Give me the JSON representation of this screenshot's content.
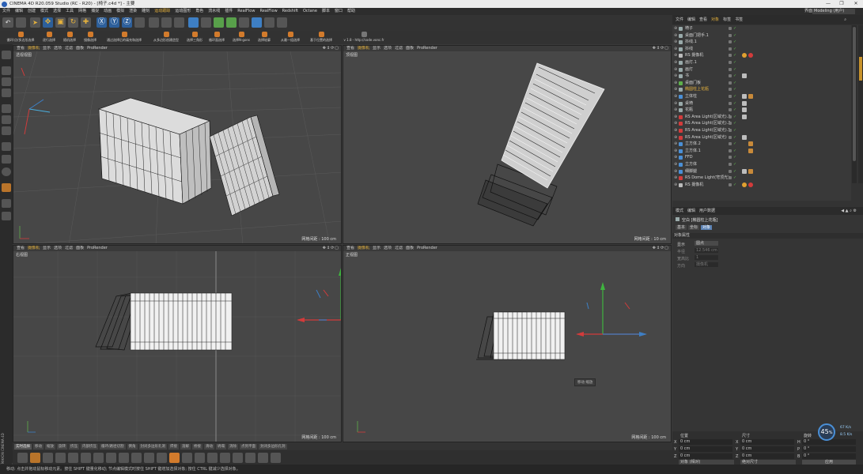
{
  "window": {
    "title": "CINEMA 4D R20.059 Studio (RC - R20) - [椅子.c4d *] - 主要",
    "controls": [
      "—",
      "❐",
      "✕"
    ]
  },
  "menubar": {
    "items": [
      "文件",
      "编辑",
      "创建",
      "模式",
      "选择",
      "工具",
      "网格",
      "捕捉",
      "动画",
      "模拟",
      "渲染",
      "雕刻",
      "运动跟踪",
      "运动图形",
      "角色",
      "流水线",
      "插件",
      "RealFlow",
      "RealFlow",
      "Redshift",
      "Octane",
      "脚本",
      "窗口",
      "帮助"
    ],
    "highlighted": "运动跟踪",
    "right_label": "界面",
    "layout_value": "Modeling (用户)"
  },
  "plugin_bar": {
    "items": [
      "循环/点/多边形选择",
      "逐行选择",
      "随机选择",
      "镜像选择",
      "通过选择后的填充和选择",
      "从多边形创建造型",
      "选择三角形",
      "循环面选择",
      "选择N-gons",
      "选择轮廓",
      "从最一组选择",
      "基于位置的选择"
    ],
    "version_label": "v 1.8 - http://code.vonc.fr"
  },
  "viewports": [
    {
      "id": "persp",
      "menu": [
        "查看",
        "摄像机",
        "显示",
        "选项",
        "过滤",
        "面板",
        "ProRender"
      ],
      "name": "透视视图",
      "grid": "网格间距 : 100 cm"
    },
    {
      "id": "top",
      "menu": [
        "查看",
        "摄像机",
        "显示",
        "选项",
        "过滤",
        "面板",
        "ProRender"
      ],
      "name": "顶视图",
      "grid": "网格间距 : 10 cm"
    },
    {
      "id": "right",
      "menu": [
        "查看",
        "摄像机",
        "显示",
        "选项",
        "过滤",
        "面板",
        "ProRender"
      ],
      "name": "右视图",
      "grid": "网格间距 : 100 cm"
    },
    {
      "id": "front",
      "menu": [
        "查看",
        "摄像机",
        "显示",
        "选项",
        "过滤",
        "面板",
        "ProRender"
      ],
      "name": "正视图",
      "grid": "网格间距 : 100 cm"
    }
  ],
  "objects_panel": {
    "tabs": [
      "文件",
      "编辑",
      "查看",
      "对象",
      "标签",
      "书签"
    ],
    "highlighted_tab": "对象",
    "items": [
      {
        "name": "椅子",
        "icon": "null-object-icon",
        "color": "#9aa"
      },
      {
        "name": "桌面门把手.1",
        "icon": "null-object-icon",
        "color": "#9aa"
      },
      {
        "name": "抖线.1",
        "icon": "null-object-icon",
        "color": "#9aa"
      },
      {
        "name": "抖线",
        "icon": "null-object-icon",
        "color": "#9aa"
      },
      {
        "name": "RS 摄像机",
        "icon": "camera-icon",
        "color": "#bbb"
      },
      {
        "name": "画灯.1",
        "icon": "null-object-icon",
        "color": "#9aa"
      },
      {
        "name": "画灯",
        "icon": "null-object-icon",
        "color": "#9aa"
      },
      {
        "name": "书",
        "icon": "null-object-icon",
        "color": "#9aa"
      },
      {
        "name": "桌面门板",
        "icon": "plane-icon",
        "color": "#5db04a"
      },
      {
        "name": "椭圆柱上花瓶",
        "icon": "null-object-icon",
        "color": "#9aa",
        "selected": true
      },
      {
        "name": "立体柱",
        "icon": "figure-icon",
        "color": "#4a8fd6"
      },
      {
        "name": "桌椅",
        "icon": "null-object-icon",
        "color": "#9aa"
      },
      {
        "name": "花瓶",
        "icon": "null-object-icon",
        "color": "#9aa"
      },
      {
        "name": "RS Area Light(区域光).3",
        "icon": "area-light-icon",
        "color": "#d23b3b"
      },
      {
        "name": "RS Area Light(区域光).2",
        "icon": "area-light-icon",
        "color": "#d23b3b"
      },
      {
        "name": "RS Area Light(区域光).1",
        "icon": "area-light-icon",
        "color": "#d23b3b"
      },
      {
        "name": "RS Area Light(区域光)",
        "icon": "area-light-icon",
        "color": "#d23b3b"
      },
      {
        "name": "立方体.2",
        "icon": "figure-icon",
        "color": "#4a8fd6"
      },
      {
        "name": "立方体.1",
        "icon": "figure-icon",
        "color": "#4a8fd6"
      },
      {
        "name": "FFD",
        "icon": "deformer-icon",
        "color": "#4a8fd6"
      },
      {
        "name": "立方体",
        "icon": "cube-icon",
        "color": "#4a8fd6"
      },
      {
        "name": "细脚腿",
        "icon": "figure-icon",
        "color": "#4a8fd6"
      },
      {
        "name": "RS Dome Light(穹顶光)",
        "icon": "dome-light-icon",
        "color": "#d23b3b"
      },
      {
        "name": "RS 摄像机",
        "icon": "camera-icon",
        "color": "#bbb"
      }
    ]
  },
  "attributes_panel": {
    "tabs": [
      "模式",
      "编辑",
      "用户数据"
    ],
    "object_title": "空白 [椭圆柱上花瓶]",
    "subtabs": [
      "基本",
      "坐标",
      "对象"
    ],
    "active_subtab": "对象",
    "section": "对象属性",
    "fields": [
      {
        "label": "显示",
        "value": "圆点"
      },
      {
        "label": "半径",
        "value": "12.546 cm"
      },
      {
        "label": "宽高比",
        "value": "1"
      },
      {
        "label": "方向",
        "value": "摄像机"
      }
    ]
  },
  "coordinates_panel": {
    "headers": [
      "位置",
      "尺寸",
      "旋转"
    ],
    "rows": [
      {
        "axis": "X",
        "pos": "0 cm",
        "size": "0 cm",
        "rot_label": "H",
        "rot": "0 °"
      },
      {
        "axis": "Y",
        "pos": "0 cm",
        "size": "0 cm",
        "rot_label": "P",
        "rot": "0 °"
      },
      {
        "axis": "Z",
        "pos": "0 cm",
        "size": "0 cm",
        "rot_label": "B",
        "rot": "0 °"
      }
    ],
    "mode_select": "对象 (相对)",
    "size_select": "绝对尺寸",
    "apply_button": "应用"
  },
  "timeline": {
    "tabs": [
      "实时选择",
      "移动",
      "缩放",
      "旋转",
      "挤压",
      "内部挤压",
      "循环/路径切割",
      "倒角",
      "封闭多边形孔洞",
      "焊接",
      "溶解",
      "桥接",
      "滑动",
      "坍塌",
      "消除",
      "点到平面",
      "封闭多边形孔洞"
    ],
    "active": "实时选择"
  },
  "hud": {
    "value": "45",
    "unit": "%",
    "up": "67 K/s",
    "down": "8.5 K/s"
  },
  "status": {
    "text": "移动: 点击并拖动鼠标移动元素。按住 SHIFT 键量化移动; 节点编辑模式时按住 SHIFT 键增加选择对象; 按住 CTRL 键减少选择对象。",
    "brand": "MAXON CINEMA 4D"
  },
  "tooltip": {
    "text": "移动 缩放"
  }
}
